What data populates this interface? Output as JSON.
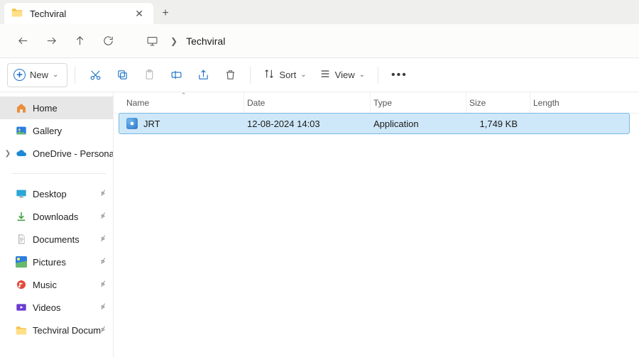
{
  "tab": {
    "title": "Techviral"
  },
  "breadcrumb": {
    "current": "Techviral"
  },
  "toolbar": {
    "new_label": "New",
    "sort_label": "Sort",
    "view_label": "View"
  },
  "sidebar": {
    "home": "Home",
    "gallery": "Gallery",
    "onedrive": "OneDrive - Persona",
    "desktop": "Desktop",
    "downloads": "Downloads",
    "documents": "Documents",
    "pictures": "Pictures",
    "music": "Music",
    "videos": "Videos",
    "techviral": "Techviral Docum"
  },
  "columns": {
    "name": "Name",
    "date": "Date",
    "type": "Type",
    "size": "Size",
    "length": "Length"
  },
  "files": [
    {
      "name": "JRT",
      "date": "12-08-2024 14:03",
      "type": "Application",
      "size": "1,749 KB",
      "length": ""
    }
  ]
}
